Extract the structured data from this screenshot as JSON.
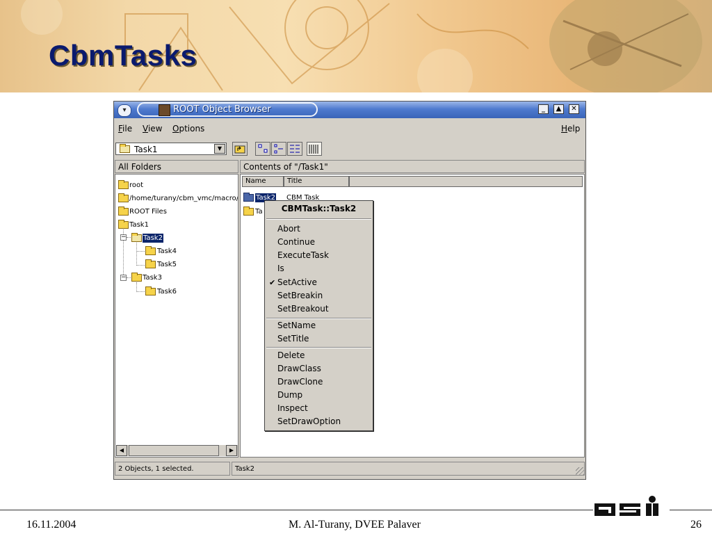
{
  "slide": {
    "title": "CbmTasks",
    "footer_date": "16.11.2004",
    "footer_author": "M. Al-Turany,  DVEE  Palaver",
    "footer_page": "26"
  },
  "window": {
    "title": "ROOT Object Browser",
    "menu": {
      "file": "File",
      "view": "View",
      "options": "Options",
      "help": "Help"
    },
    "combo_value": "Task1",
    "all_folders": "All Folders",
    "contents_of": "Contents of \"/Task1\"",
    "tree": {
      "root": "root",
      "path": "/home/turany/cbm_vmc/macro/c",
      "root_files": "ROOT Files",
      "task1": "Task1",
      "task2": "Task2",
      "task4": "Task4",
      "task5": "Task5",
      "task3": "Task3",
      "task6": "Task6"
    },
    "columns": {
      "name": "Name",
      "title": "Title"
    },
    "list": [
      {
        "name": "Task2",
        "title": "CBM Task"
      },
      {
        "name": "Ta",
        "title": ""
      }
    ],
    "status_left": "2 Objects, 1 selected.",
    "status_right": "Task2"
  },
  "context_menu": {
    "title": "CBMTask::Task2",
    "group1": [
      "Abort",
      "Continue",
      "ExecuteTask",
      "Is",
      "SetActive",
      "SetBreakin",
      "SetBreakout"
    ],
    "group2": [
      "SetName",
      "SetTitle"
    ],
    "group3": [
      "Delete",
      "DrawClass",
      "DrawClone",
      "Dump",
      "Inspect",
      "SetDrawOption"
    ],
    "checked_item": "SetActive"
  },
  "icons": {
    "gsi_logo": "gsi-logo",
    "titlebar_buttons": [
      "minimize-icon",
      "maximize-icon",
      "close-icon"
    ]
  }
}
